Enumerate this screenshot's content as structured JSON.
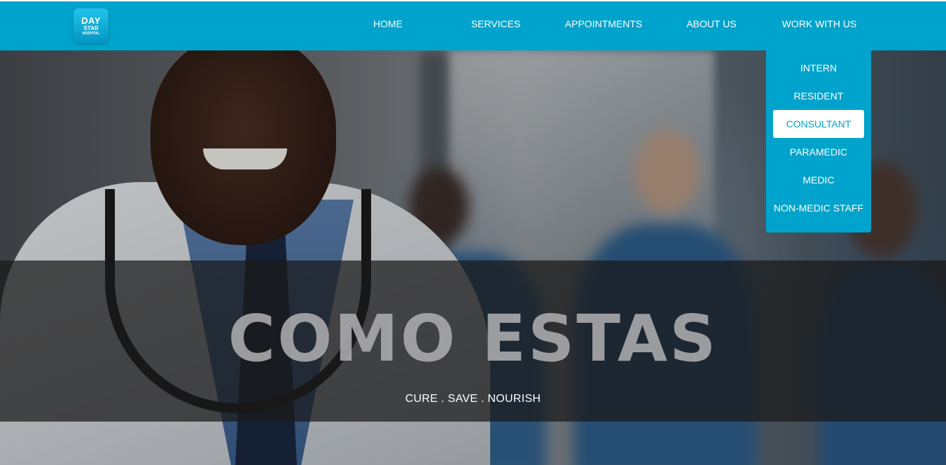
{
  "brand": {
    "logo_line1": "DAY",
    "logo_line2": "STAR",
    "logo_line3": "HOSPITAL",
    "accent_color": "#00a3cb"
  },
  "nav": {
    "items": [
      {
        "label": "HOME"
      },
      {
        "label": "SERVICES"
      },
      {
        "label": "APPOINTMENTS"
      },
      {
        "label": "ABOUT US"
      },
      {
        "label": "WORK WITH US"
      }
    ]
  },
  "dropdown": {
    "parent": "WORK WITH US",
    "items": [
      {
        "label": "INTERN"
      },
      {
        "label": "RESIDENT"
      },
      {
        "label": "CONSULTANT",
        "highlighted": true
      },
      {
        "label": "PARAMEDIC"
      },
      {
        "label": "MEDIC"
      },
      {
        "label": "NON-MEDIC STAFF"
      }
    ]
  },
  "hero": {
    "title": "COMO ESTAS",
    "tagline": "CURE . SAVE . NOURISH"
  }
}
